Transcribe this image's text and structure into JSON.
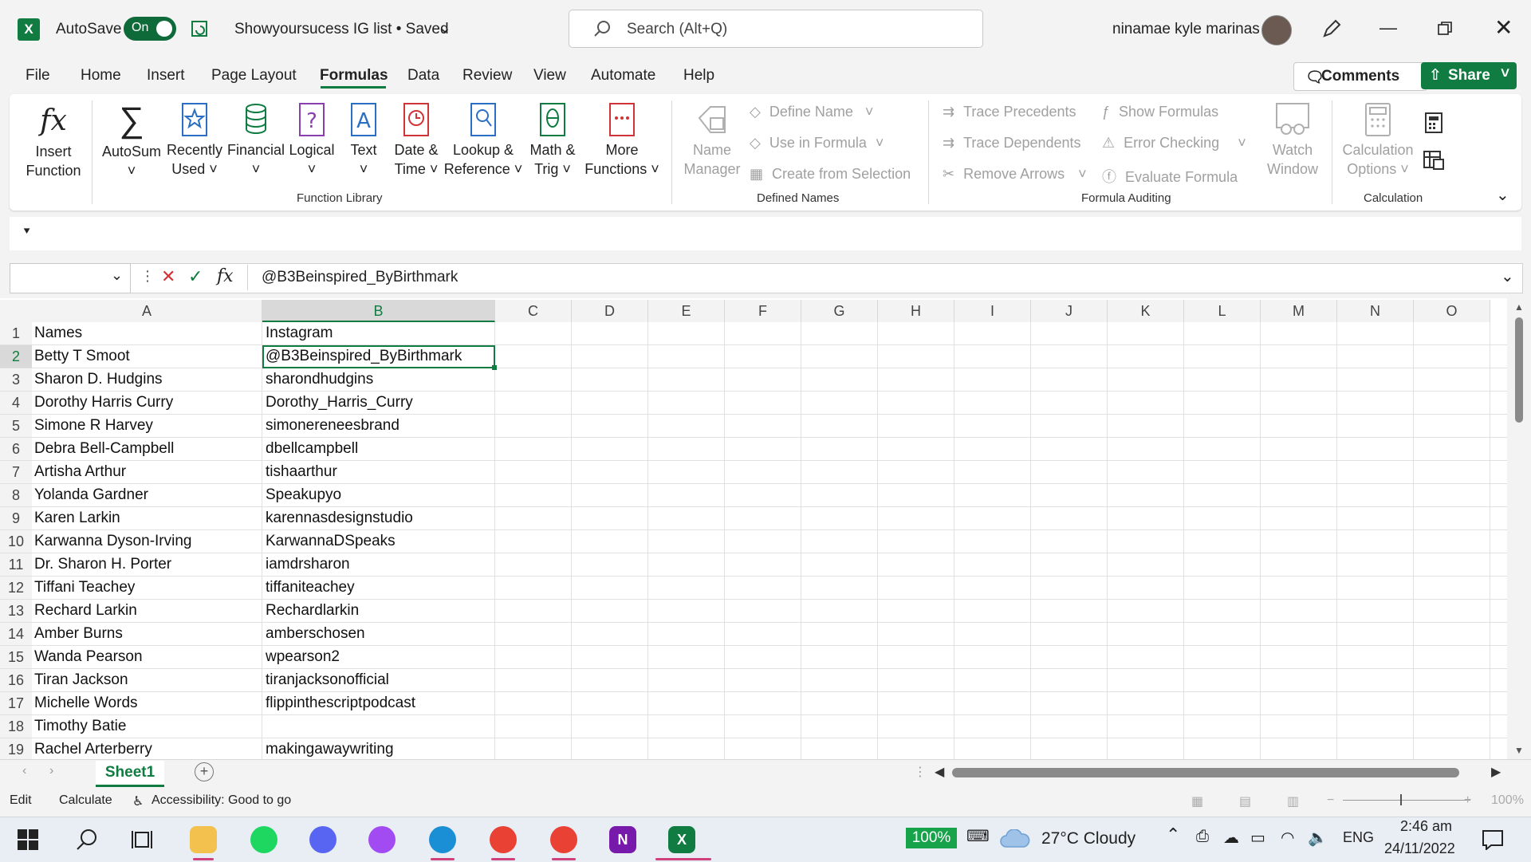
{
  "titlebar": {
    "app_letter": "X",
    "autosave_label": "AutoSave",
    "autosave_state": "On",
    "doc_title": "Showyoursucess IG list • Saved",
    "search_placeholder": "Search (Alt+Q)",
    "user_name": "ninamae kyle marinas"
  },
  "menu": {
    "tabs": [
      "File",
      "Home",
      "Insert",
      "Page Layout",
      "Formulas",
      "Data",
      "Review",
      "View",
      "Automate",
      "Help"
    ],
    "active": "Formulas",
    "comments_label": "Comments",
    "share_label": "Share"
  },
  "ribbon": {
    "function_library": {
      "group_label": "Function Library",
      "items": [
        {
          "line1": "Insert",
          "line2": "Function"
        },
        {
          "line1": "AutoSum",
          "line2": "˅"
        },
        {
          "line1": "Recently",
          "line2": "Used ˅"
        },
        {
          "line1": "Financial",
          "line2": "˅"
        },
        {
          "line1": "Logical",
          "line2": "˅"
        },
        {
          "line1": "Text",
          "line2": "˅"
        },
        {
          "line1": "Date &",
          "line2": "Time ˅"
        },
        {
          "line1": "Lookup &",
          "line2": "Reference ˅"
        },
        {
          "line1": "Math &",
          "line2": "Trig ˅"
        },
        {
          "line1": "More",
          "line2": "Functions ˅"
        }
      ]
    },
    "defined_names": {
      "group_label": "Defined Names",
      "manager_line1": "Name",
      "manager_line2": "Manager",
      "define_name": "Define Name",
      "use_in_formula": "Use in Formula",
      "create_from_selection": "Create from Selection"
    },
    "formula_auditing": {
      "group_label": "Formula Auditing",
      "trace_precedents": "Trace Precedents",
      "trace_dependents": "Trace Dependents",
      "remove_arrows": "Remove Arrows",
      "show_formulas": "Show Formulas",
      "error_checking": "Error Checking",
      "evaluate_formula": "Evaluate Formula",
      "watch_line1": "Watch",
      "watch_line2": "Window"
    },
    "calculation": {
      "group_label": "Calculation",
      "options_line1": "Calculation",
      "options_line2": "Options ˅"
    }
  },
  "formula_bar": {
    "name_box": "",
    "fx_label": "fx",
    "content": "@B3Beinspired_ByBirthmark"
  },
  "grid": {
    "columns": [
      "A",
      "B",
      "C",
      "D",
      "E",
      "F",
      "G",
      "H",
      "I",
      "J",
      "K",
      "L",
      "M",
      "N",
      "O"
    ],
    "selected_cell": "B2",
    "rows": [
      {
        "n": "1",
        "a": "Names",
        "b": "Instagram"
      },
      {
        "n": "2",
        "a": "Betty T Smoot",
        "b": "@B3Beinspired_ByBirthmark"
      },
      {
        "n": "3",
        "a": "Sharon D. Hudgins",
        "b": "sharondhudgins"
      },
      {
        "n": "4",
        "a": "Dorothy Harris Curry",
        "b": "Dorothy_Harris_Curry"
      },
      {
        "n": "5",
        "a": "Simone R Harvey",
        "b": "simonereneesbrand"
      },
      {
        "n": "6",
        "a": "Debra Bell-Campbell",
        "b": "dbellcampbell"
      },
      {
        "n": "7",
        "a": "Artisha Arthur",
        "b": "tishaarthur"
      },
      {
        "n": "8",
        "a": "Yolanda Gardner",
        "b": "Speakupyo"
      },
      {
        "n": "9",
        "a": "Karen Larkin",
        "b": "karennasdesignstudio"
      },
      {
        "n": "10",
        "a": "Karwanna Dyson-Irving",
        "b": "KarwannaDSpeaks"
      },
      {
        "n": "11",
        "a": "Dr. Sharon H. Porter",
        "b": "iamdrsharon"
      },
      {
        "n": "12",
        "a": "Tiffani Teachey",
        "b": "tiffaniteachey"
      },
      {
        "n": "13",
        "a": "Rechard Larkin",
        "b": "Rechardlarkin"
      },
      {
        "n": "14",
        "a": "Amber Burns",
        "b": "amberschosen"
      },
      {
        "n": "15",
        "a": "Wanda Pearson",
        "b": "wpearson2"
      },
      {
        "n": "16",
        "a": "Tiran Jackson",
        "b": "tiranjacksonofficial"
      },
      {
        "n": "17",
        "a": "Michelle Words",
        "b": "flippinthescriptpodcast"
      },
      {
        "n": "18",
        "a": "Timothy Batie",
        "b": ""
      },
      {
        "n": "19",
        "a": "Rachel Arterberry",
        "b": "makingawaywriting"
      }
    ]
  },
  "sheets": {
    "active": "Sheet1"
  },
  "statusbar": {
    "mode": "Edit",
    "calculate": "Calculate",
    "accessibility": "Accessibility: Good to go",
    "zoom": "100%"
  },
  "taskbar": {
    "battery": "100%",
    "weather": "27°C  Cloudy",
    "lang": "ENG",
    "time": "2:46 am",
    "date": "24/11/2022"
  },
  "colors": {
    "accent": "#107c41",
    "dim": "#a0a0a0"
  }
}
